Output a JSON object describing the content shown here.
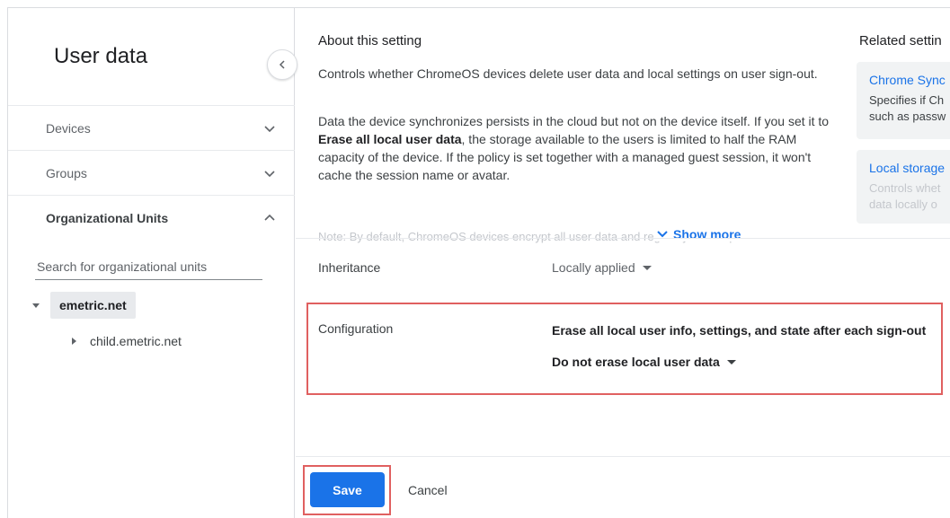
{
  "sidebar": {
    "title": "User data",
    "sections": [
      {
        "label": "Devices"
      },
      {
        "label": "Groups"
      },
      {
        "label": "Organizational Units"
      }
    ],
    "search_placeholder": "Search for organizational units",
    "tree": {
      "root": "emetric.net",
      "child": "child.emetric.net"
    }
  },
  "about": {
    "title": "About this setting",
    "p1": "Controls whether ChromeOS devices delete user data and local settings on user sign-out.",
    "p2_pre": "Data the device synchronizes persists in the cloud but not on the device itself. If you set it to ",
    "p2_bold": "Erase all local user data",
    "p2_post": ", the storage available to the users is limited to half the RAM capacity of the device. If the policy is set together with a managed guest session, it won't cache the session name or avatar.",
    "p3_note": "Note:",
    "p3": " By default, ChromeOS devices encrypt all user data and regularly clean up",
    "show_more": "Show more"
  },
  "related": {
    "title": "Related settin",
    "cards": [
      {
        "title": "Chrome Sync",
        "desc1": "Specifies if Ch",
        "desc2": "such as passw"
      },
      {
        "title": "Local storage",
        "desc1": "Controls whet",
        "desc2": "data locally o"
      }
    ]
  },
  "inheritance": {
    "label": "Inheritance",
    "value": "Locally applied"
  },
  "configuration": {
    "label": "Configuration",
    "heading": "Erase all local user info, settings, and state after each sign-out",
    "value": "Do not erase local user data"
  },
  "footer": {
    "save": "Save",
    "cancel": "Cancel"
  },
  "colors": {
    "accent": "#1a73e8",
    "highlight_border": "#e06060"
  }
}
